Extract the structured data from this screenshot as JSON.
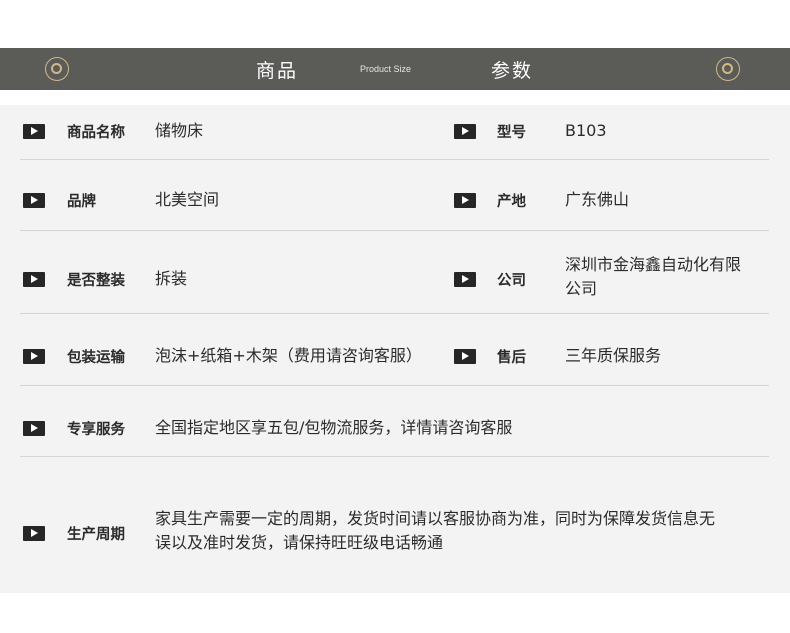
{
  "header": {
    "title_left": "商品",
    "subtitle": "Product Size",
    "title_right": "参数",
    "icon_left": "ring-icon",
    "icon_right": "ring-icon"
  },
  "rows": [
    {
      "label": "商品名称",
      "value": "储物床",
      "label2": "型号",
      "value2": "B103"
    },
    {
      "label": "品牌",
      "value": "北美空间",
      "label2": "产地",
      "value2": "广东佛山"
    },
    {
      "label": "是否整装",
      "value": "拆装",
      "label2": "公司",
      "value2": "深圳市金海鑫自动化有限公司"
    },
    {
      "label": "包装运输",
      "value": "泡沫+纸箱+木架（费用请咨询客服）",
      "label2": "售后",
      "value2": "三年质保服务"
    },
    {
      "label": "专享服务",
      "value": "全国指定地区享五包/包物流服务，详情请咨询客服"
    },
    {
      "label": "生产周期",
      "value": "家具生产需要一定的周期，发货时间请以客服协商为准，同时为保障发货信息无误以及准时发货，请保持旺旺级电话畅通"
    }
  ],
  "colors": {
    "banner": "#5b5b58",
    "panel": "#f3f3f3",
    "accent_gold": "#cfb98a",
    "icon": "#262626"
  }
}
